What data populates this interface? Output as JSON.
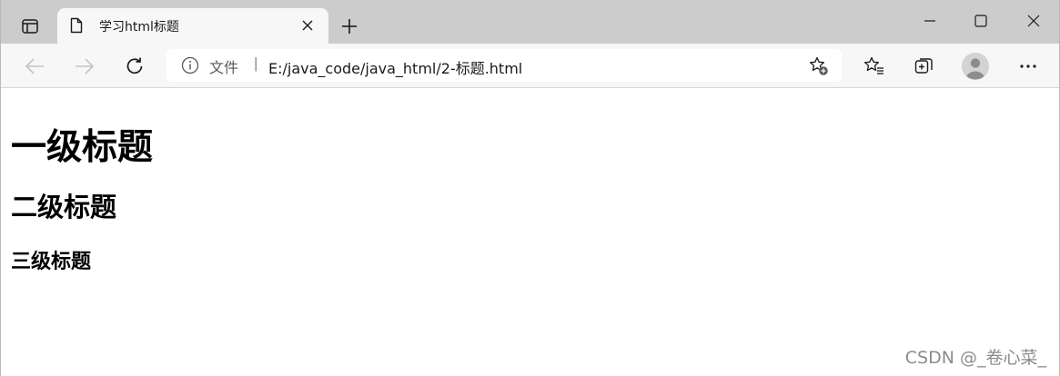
{
  "tab": {
    "title": "学习html标题"
  },
  "address_bar": {
    "site_label": "文件",
    "separator": "|",
    "url": "E:/java_code/java_html/2-标题.html"
  },
  "page": {
    "h1": "一级标题",
    "h2": "二级标题",
    "h3": "三级标题"
  },
  "watermark": "CSDN @_卷心菜_",
  "icons": {
    "tab_actions": "tab-actions-icon",
    "page": "document-icon",
    "close_tab": "close-icon",
    "new_tab": "plus-icon",
    "minimize": "minimize-icon",
    "maximize": "maximize-icon",
    "close_window": "close-icon",
    "back": "back-arrow-icon",
    "forward": "forward-arrow-icon",
    "refresh": "refresh-icon",
    "info": "info-icon",
    "add_favorite": "star-add-icon",
    "favorites": "favorites-list-icon",
    "collections": "collections-icon",
    "profile": "profile-avatar-icon",
    "more": "ellipsis-icon"
  },
  "colors": {
    "tabstrip_bg": "#cccccc",
    "toolbar_bg": "#f7f7f7",
    "watermark": "#8c8c8c"
  }
}
